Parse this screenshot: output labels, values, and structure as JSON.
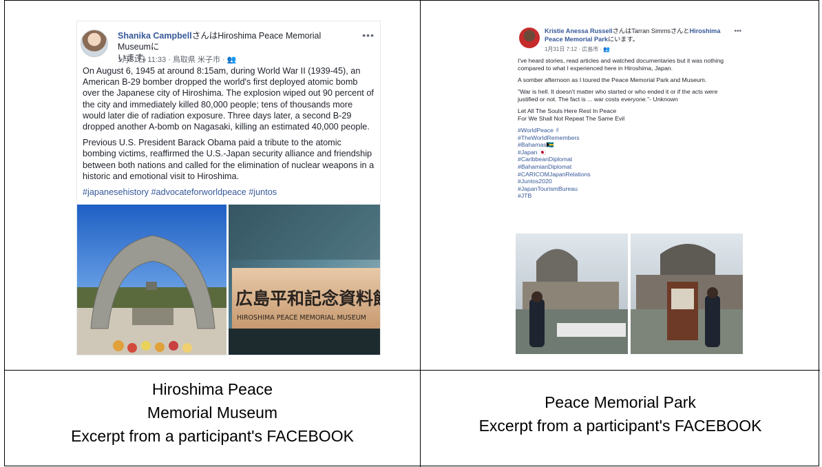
{
  "post1": {
    "name": "Shanika Campbell",
    "name_suffix": "さんはHiroshima Peace Memorial Museumに",
    "name_line2": "います。",
    "more": "•••",
    "meta": "1月31日 11:33 · 鳥取県 米子市 · 👥",
    "paragraph1": "On August 6, 1945 at around 8:15am, during World War II (1939-45), an American B-29 bomber dropped the world's first deployed atomic bomb over the Japanese city of Hiroshima. The explosion wiped out 90 percent of the city and immediately killed 80,000 people; tens of thousands more would later die of radiation exposure. Three days later, a second B-29 dropped another A-bomb on Nagasaki, killing an estimated 40,000 people.",
    "paragraph2": "Previous U.S. President Barack Obama paid a tribute to the atomic bombing victims, reaffirmed the U.S.-Japan security alliance and friendship between both nations and called for the elimination of nuclear weapons in a historic and emotional visit to Hiroshima.",
    "hashtags": "#japanesehistory #advocateforworldpeace #juntos",
    "sign_jp": "広島平和記念資料館",
    "sign_en": "HIROSHIMA PEACE MEMORIAL MUSEUM"
  },
  "post2": {
    "name": "Kristie Anessa Russell",
    "name_suffix": "さんはTarran Simmsさんと",
    "name_place": "Hiroshima Peace Memorial Park",
    "name_end": "にいます。",
    "more": "•••",
    "meta": "1月31日 7:12 · 広島市 · 👥",
    "p1": "I've heard stories, read articles and watched documentaries but it was nothing compared to what I experienced here in Hiroshima, Japan.",
    "p2": "A somber afternoon as I toured the Peace Memorial Park and Museum.",
    "p3": "\"War is hell. It doesn't matter who started or who ended it or if the acts were justified or not. The fact is ... war costs everyone.\"- Unknown",
    "p4a": "Let All The Souls Here Rest In Peace",
    "p4b": "For We Shall Not Repeat The Same Evil",
    "tags": [
      "#WorldPeace ✌",
      "#TheWorldRemembers",
      "#Bahamas🇧🇸",
      "#Japan 🇯🇵",
      "#CaribbeanDiplomat",
      "#BahamianDiplomat",
      "#CARICOMJapanRelations",
      "#Juntos2020",
      "#JapanTourismBureau",
      "#JTB"
    ]
  },
  "captions": {
    "left": [
      "Hiroshima Peace",
      "Memorial Museum",
      "Excerpt from a participant's FACEBOOK"
    ],
    "right": [
      "Peace Memorial Park",
      "Excerpt from a participant's FACEBOOK"
    ]
  }
}
